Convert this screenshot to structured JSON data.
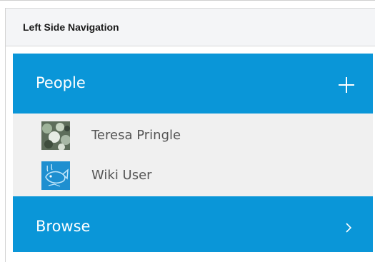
{
  "section": {
    "title": "Left Side Navigation"
  },
  "nav": {
    "people": {
      "label": "People",
      "action_icon": "plus-icon",
      "members": [
        {
          "name": "Teresa Pringle",
          "avatar": "teresa-avatar"
        },
        {
          "name": "Wiki User",
          "avatar": "wiki-user-avatar"
        }
      ]
    },
    "browse": {
      "label": "Browse",
      "action_icon": "chevron-right-icon"
    }
  },
  "colors": {
    "accent": "#0a96d8",
    "list_background": "#f0f0f0",
    "header_background": "#f4f5f7"
  }
}
